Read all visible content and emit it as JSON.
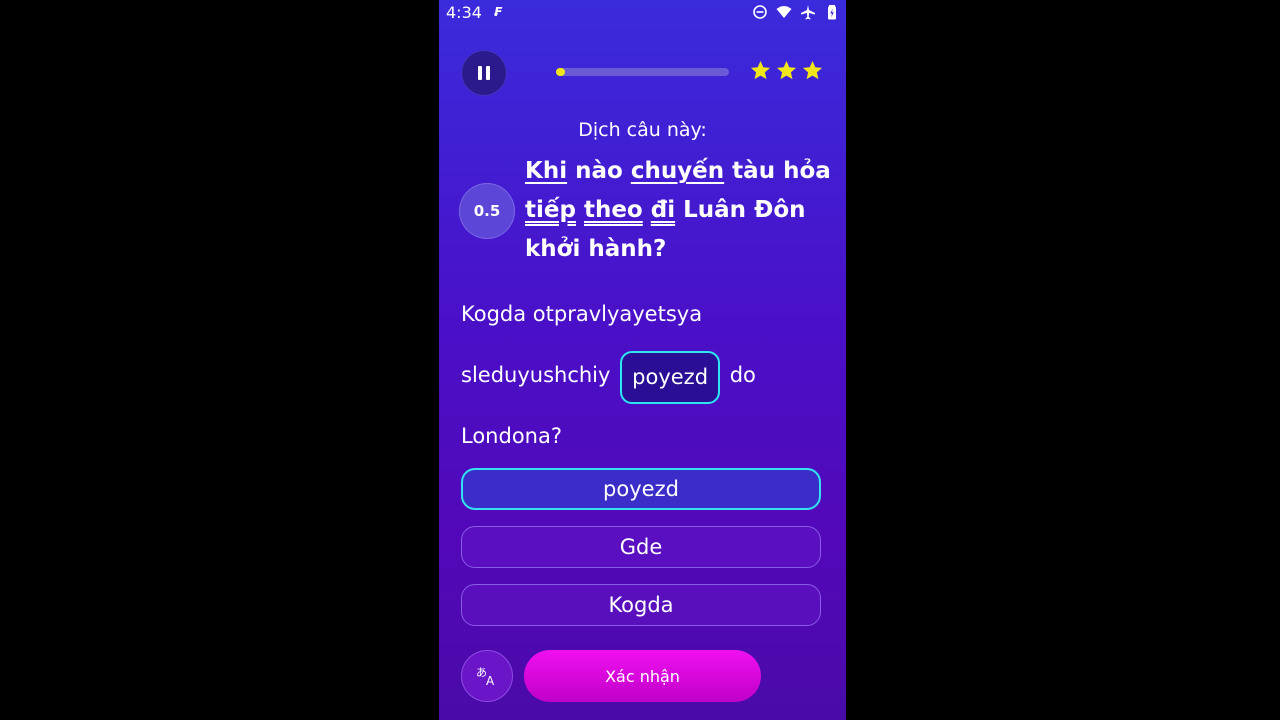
{
  "status_bar": {
    "time": "4:34",
    "icons": [
      "notification-app-icon",
      "do-not-disturb-icon",
      "wifi-icon",
      "airplane-mode-icon",
      "battery-icon"
    ]
  },
  "header": {
    "pause_icon": "pause-icon",
    "progress": 0.05,
    "stars": 3,
    "star_color": "#f1e61a"
  },
  "question": {
    "prompt_label": "Dịch câu này:",
    "level": "0.5",
    "words": [
      {
        "text": "Khi",
        "underline": "single"
      },
      {
        "text": " nào ",
        "underline": "none"
      },
      {
        "text": "chuyến",
        "underline": "single"
      },
      {
        "text": " tàu hỏa ",
        "underline": "none"
      },
      {
        "text": "tiếp",
        "underline": "double"
      },
      {
        "text": " ",
        "underline": "none"
      },
      {
        "text": "theo",
        "underline": "double"
      },
      {
        "text": " ",
        "underline": "none"
      },
      {
        "text": "đi",
        "underline": "double"
      },
      {
        "text": " Luân Đôn khởi hành?",
        "underline": "none"
      }
    ]
  },
  "answer": {
    "line1": "Kogda otpravlyayetsya",
    "line2_before": "sleduyushchiy",
    "slot_word": "poyezd",
    "line2_after": "do",
    "line3": "Londona?"
  },
  "options": [
    {
      "label": "poyezd",
      "selected": true
    },
    {
      "label": "Gde",
      "selected": false
    },
    {
      "label": "Kogda",
      "selected": false
    }
  ],
  "footer": {
    "translate_icon": "translate-icon",
    "confirm_label": "Xác nhận"
  },
  "colors": {
    "accent_cyan": "#2ee6f0",
    "confirm_magenta": "#e60ae6",
    "background_top": "#3a2bdc",
    "background_bottom": "#4a0aa8"
  }
}
